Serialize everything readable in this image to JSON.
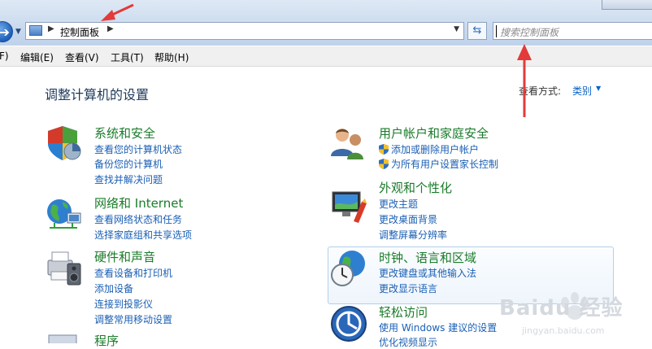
{
  "address_bar": {
    "breadcrumb": "控制面板",
    "search_placeholder": "搜索控制面板"
  },
  "menu": {
    "items": [
      "F)",
      "编辑(E)",
      "查看(V)",
      "工具(T)",
      "帮助(H)"
    ]
  },
  "main": {
    "title": "调整计算机的设置",
    "view_by_label": "查看方式:",
    "view_by_value": "类别"
  },
  "left_categories": [
    {
      "title": "系统和安全",
      "icon": "shield-icon",
      "links": [
        "查看您的计算机状态",
        "备份您的计算机",
        "查找并解决问题"
      ]
    },
    {
      "title": "网络和 Internet",
      "icon": "network-globe-icon",
      "links": [
        "查看网络状态和任务",
        "选择家庭组和共享选项"
      ]
    },
    {
      "title": "硬件和声音",
      "icon": "printer-speaker-icon",
      "links": [
        "查看设备和打印机",
        "添加设备",
        "连接到投影仪",
        "调整常用移动设置"
      ]
    },
    {
      "title": "程序",
      "icon": "programs-icon",
      "links": []
    }
  ],
  "right_categories": [
    {
      "title": "用户帐户和家庭安全",
      "icon": "users-icon",
      "links": [
        "添加或删除用户帐户",
        "为所有用户设置家长控制"
      ]
    },
    {
      "title": "外观和个性化",
      "icon": "monitor-paint-icon",
      "links": [
        "更改主题",
        "更改桌面背景",
        "调整屏幕分辨率"
      ]
    },
    {
      "title": "时钟、语言和区域",
      "icon": "clock-globe-icon",
      "links": [
        "更改键盘或其他输入法",
        "更改显示语言"
      ]
    },
    {
      "title": "轻松访问",
      "icon": "ease-of-access-icon",
      "links": [
        "使用 Windows 建议的设置",
        "优化视频显示"
      ]
    }
  ],
  "watermark": {
    "text": "Baidu 经验",
    "sub": "jingyan.baidu.com"
  },
  "colors": {
    "category_title": "#1a7b2a",
    "link": "#1a5fb4",
    "heading": "#1e395b",
    "annotation_arrow": "#e33a3a"
  }
}
